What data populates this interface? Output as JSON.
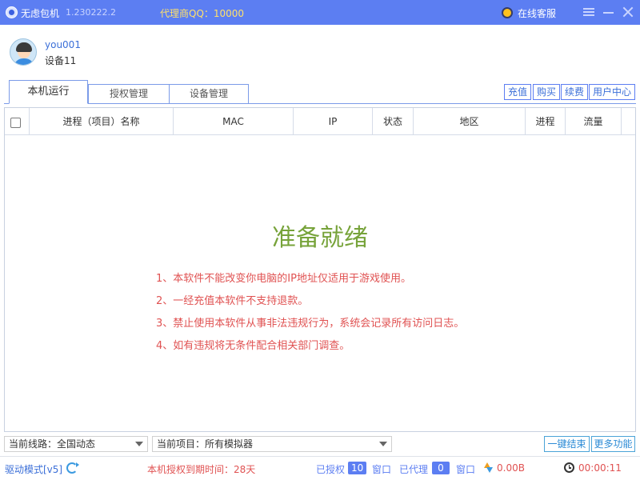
{
  "titlebar": {
    "app_name": "无虑包机",
    "version": "1.230222.2",
    "agent_qq": "代理商QQ：10000",
    "service_label": "在线客服"
  },
  "user": {
    "username": "you001",
    "device": "设备11"
  },
  "tabs": [
    {
      "label": "本机运行",
      "active": true
    },
    {
      "label": "授权管理",
      "active": false
    },
    {
      "label": "设备管理",
      "active": false
    }
  ],
  "actions": [
    "充值",
    "购买",
    "续费",
    "用户中心"
  ],
  "table": {
    "columns": [
      "进程（项目）名称",
      "MAC",
      "IP",
      "状态",
      "地区",
      "进程",
      "流量"
    ],
    "rows": []
  },
  "ready": {
    "title": "准备就绪",
    "notices": [
      "1、本软件不能改变你电脑的IP地址仅适用于游戏使用。",
      "2、一经充值本软件不支持退款。",
      "3、禁止使用本软件从事非法违规行为，系统会记录所有访问日志。",
      "4、如有违规将无条件配合相关部门调查。"
    ]
  },
  "selectors": {
    "route": "当前线路：全国动态",
    "project": "当前项目：所有模拟器"
  },
  "bottom_buttons": [
    "一键结束",
    "更多功能"
  ],
  "status": {
    "driver_mode": "驱动模式[v5]",
    "auth_expiry": "本机授权到期时间：28天",
    "authorized_label": "已授权",
    "authorized_count": "10",
    "window_label_1": "窗口",
    "proxied_label": "已代理",
    "proxied_count": "0",
    "window_label_2": "窗口",
    "speed": "0.00B",
    "elapsed": "00:00:11"
  },
  "colors": {
    "titlebar": "#5c7ef2",
    "ready_green": "#77a33a",
    "notice_red": "#e05252",
    "agent_yellow": "#ffe16b",
    "accent_blue": "#3b6fd8"
  }
}
